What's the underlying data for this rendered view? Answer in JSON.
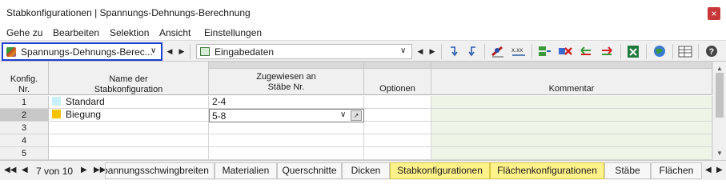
{
  "window": {
    "title": "Stabkonfigurationen | Spannungs-Dehnungs-Berechnung",
    "close_glyph": "×"
  },
  "menu": [
    "Gehe zu",
    "Bearbeiten",
    "Selektion",
    "Ansicht",
    "Einstellungen"
  ],
  "toolbar": {
    "module_combo": "Spannungs-Dehnungs-Berec...",
    "view_combo": "Eingabedaten",
    "icons": [
      "jump-icon",
      "jump-back-icon",
      "pen-icon",
      "xxx-columns-icon",
      "insert-row-icon",
      "delete-row-icon",
      "arrow-left-icon",
      "arrow-right-icon",
      "excel-export-icon",
      "globe-icon",
      "table-settings-icon",
      "help-icon"
    ]
  },
  "table": {
    "headers": {
      "no": "Konfig.\nNr.",
      "name": "Name der\nStabkonfiguration",
      "assigned": "Zugewiesen an\nStäbe Nr.",
      "options": "Optionen",
      "comment": "Kommentar"
    },
    "rows": [
      {
        "no": "1",
        "name": "Standard",
        "color": "#c8f0f8",
        "assigned": "2-4"
      },
      {
        "no": "2",
        "name": "Biegung",
        "color": "#f5c400",
        "assigned": "5-8",
        "selected": true
      },
      {
        "no": "3",
        "name": "",
        "assigned": ""
      },
      {
        "no": "4",
        "name": "",
        "assigned": ""
      },
      {
        "no": "5",
        "name": "",
        "assigned": ""
      }
    ]
  },
  "tabs": {
    "page_info": "7 von 10",
    "items": [
      {
        "label": "Spannungsschwingbreiten",
        "highlight": false
      },
      {
        "label": "Materialien",
        "highlight": false
      },
      {
        "label": "Querschnitte",
        "highlight": false
      },
      {
        "label": "Dicken",
        "highlight": false
      },
      {
        "label": "Stabkonfigurationen",
        "highlight": true
      },
      {
        "label": "Flächenkonfigurationen",
        "highlight": true
      },
      {
        "label": "Stäbe",
        "highlight": false
      },
      {
        "label": "Flächen",
        "highlight": false
      }
    ]
  }
}
